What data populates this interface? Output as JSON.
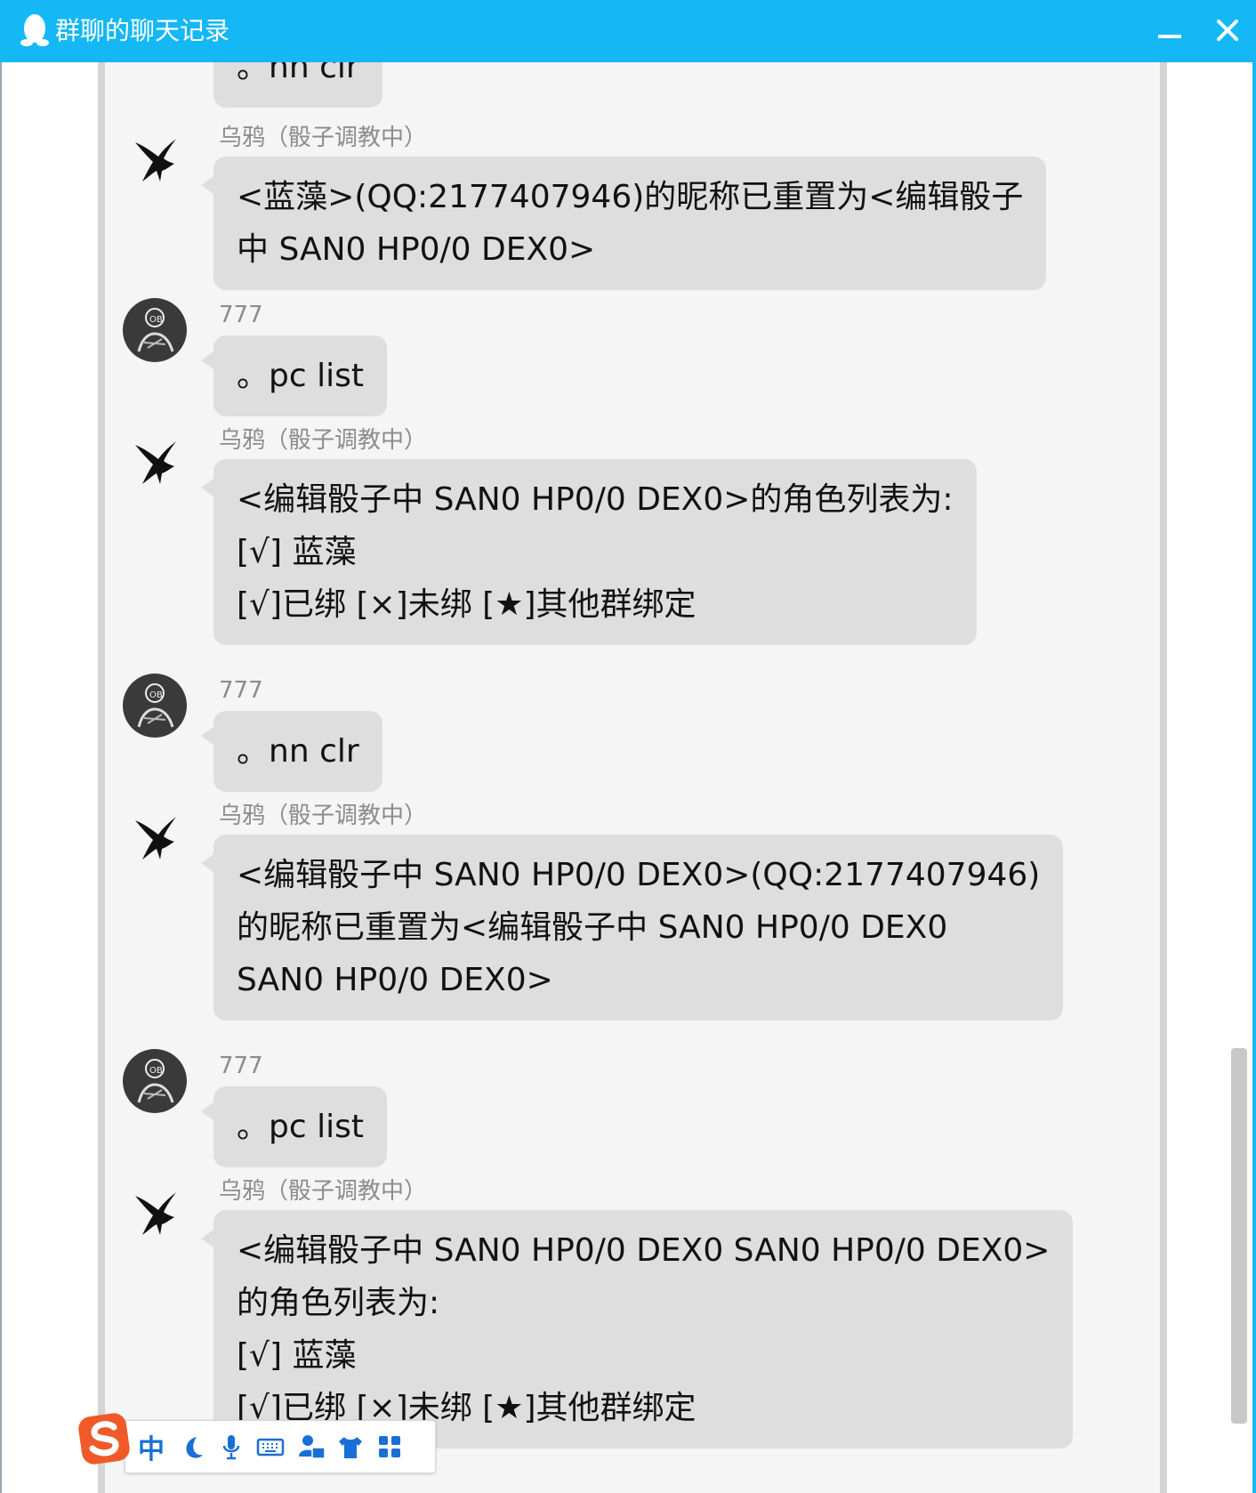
{
  "window": {
    "title": "群聊的聊天记录"
  },
  "messages": [
    {
      "sender": "",
      "lines": [
        "。nn clr"
      ]
    },
    {
      "sender": "乌鸦（骰子调教中）",
      "lines": [
        "<蓝藻>(QQ:2177407946)的昵称已重置为<编辑骰子",
        "中 SAN0 HP0/0 DEX0>"
      ]
    },
    {
      "sender": "777",
      "lines": [
        "。pc list"
      ]
    },
    {
      "sender": "乌鸦（骰子调教中）",
      "lines": [
        "<编辑骰子中 SAN0 HP0/0 DEX0>的角色列表为:",
        "[√] 蓝藻",
        "[√]已绑 [×]未绑 [★]其他群绑定"
      ]
    },
    {
      "sender": "777",
      "lines": [
        "。nn clr"
      ]
    },
    {
      "sender": "乌鸦（骰子调教中）",
      "lines": [
        "<编辑骰子中 SAN0 HP0/0 DEX0>(QQ:2177407946)",
        "的昵称已重置为<编辑骰子中 SAN0 HP0/0 DEX0",
        "SAN0 HP0/0 DEX0>"
      ]
    },
    {
      "sender": "777",
      "lines": [
        "。pc list"
      ]
    },
    {
      "sender": "乌鸦（骰子调教中）",
      "lines": [
        "<编辑骰子中 SAN0 HP0/0 DEX0 SAN0 HP0/0 DEX0>",
        "的角色列表为:",
        "[√] 蓝藻",
        "[√]已绑 [×]未绑 [★]其他群绑定"
      ]
    }
  ],
  "ime": {
    "mode": "中"
  },
  "colors": {
    "titlebar": "#14b8f4",
    "bubble": "#dedede",
    "panel": "#f5f5f5"
  }
}
